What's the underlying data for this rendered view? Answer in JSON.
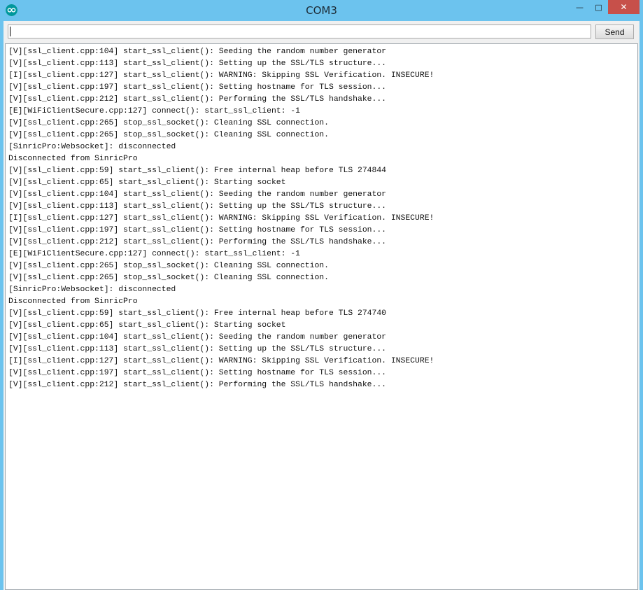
{
  "window": {
    "title": "COM3",
    "icon": "arduino-infinity-icon",
    "controls": {
      "minimize": "—",
      "maximize": "□",
      "close": "✕"
    },
    "colors": {
      "titlebar": "#6cc3ee",
      "close": "#c7504a",
      "icon": "#00979c"
    }
  },
  "input": {
    "value": "",
    "send_label": "Send"
  },
  "log": [
    "[V][ssl_client.cpp:104] start_ssl_client(): Seeding the random number generator",
    "[V][ssl_client.cpp:113] start_ssl_client(): Setting up the SSL/TLS structure...",
    "[I][ssl_client.cpp:127] start_ssl_client(): WARNING: Skipping SSL Verification. INSECURE!",
    "[V][ssl_client.cpp:197] start_ssl_client(): Setting hostname for TLS session...",
    "[V][ssl_client.cpp:212] start_ssl_client(): Performing the SSL/TLS handshake...",
    "[E][WiFiClientSecure.cpp:127] connect(): start_ssl_client: -1",
    "[V][ssl_client.cpp:265] stop_ssl_socket(): Cleaning SSL connection.",
    "[V][ssl_client.cpp:265] stop_ssl_socket(): Cleaning SSL connection.",
    "[SinricPro:Websocket]: disconnected",
    "Disconnected from SinricPro",
    "[V][ssl_client.cpp:59] start_ssl_client(): Free internal heap before TLS 274844",
    "[V][ssl_client.cpp:65] start_ssl_client(): Starting socket",
    "[V][ssl_client.cpp:104] start_ssl_client(): Seeding the random number generator",
    "[V][ssl_client.cpp:113] start_ssl_client(): Setting up the SSL/TLS structure...",
    "[I][ssl_client.cpp:127] start_ssl_client(): WARNING: Skipping SSL Verification. INSECURE!",
    "[V][ssl_client.cpp:197] start_ssl_client(): Setting hostname for TLS session...",
    "[V][ssl_client.cpp:212] start_ssl_client(): Performing the SSL/TLS handshake...",
    "[E][WiFiClientSecure.cpp:127] connect(): start_ssl_client: -1",
    "[V][ssl_client.cpp:265] stop_ssl_socket(): Cleaning SSL connection.",
    "[V][ssl_client.cpp:265] stop_ssl_socket(): Cleaning SSL connection.",
    "[SinricPro:Websocket]: disconnected",
    "Disconnected from SinricPro",
    "[V][ssl_client.cpp:59] start_ssl_client(): Free internal heap before TLS 274740",
    "[V][ssl_client.cpp:65] start_ssl_client(): Starting socket",
    "[V][ssl_client.cpp:104] start_ssl_client(): Seeding the random number generator",
    "[V][ssl_client.cpp:113] start_ssl_client(): Setting up the SSL/TLS structure...",
    "[I][ssl_client.cpp:127] start_ssl_client(): WARNING: Skipping SSL Verification. INSECURE!",
    "[V][ssl_client.cpp:197] start_ssl_client(): Setting hostname for TLS session...",
    "[V][ssl_client.cpp:212] start_ssl_client(): Performing the SSL/TLS handshake..."
  ]
}
